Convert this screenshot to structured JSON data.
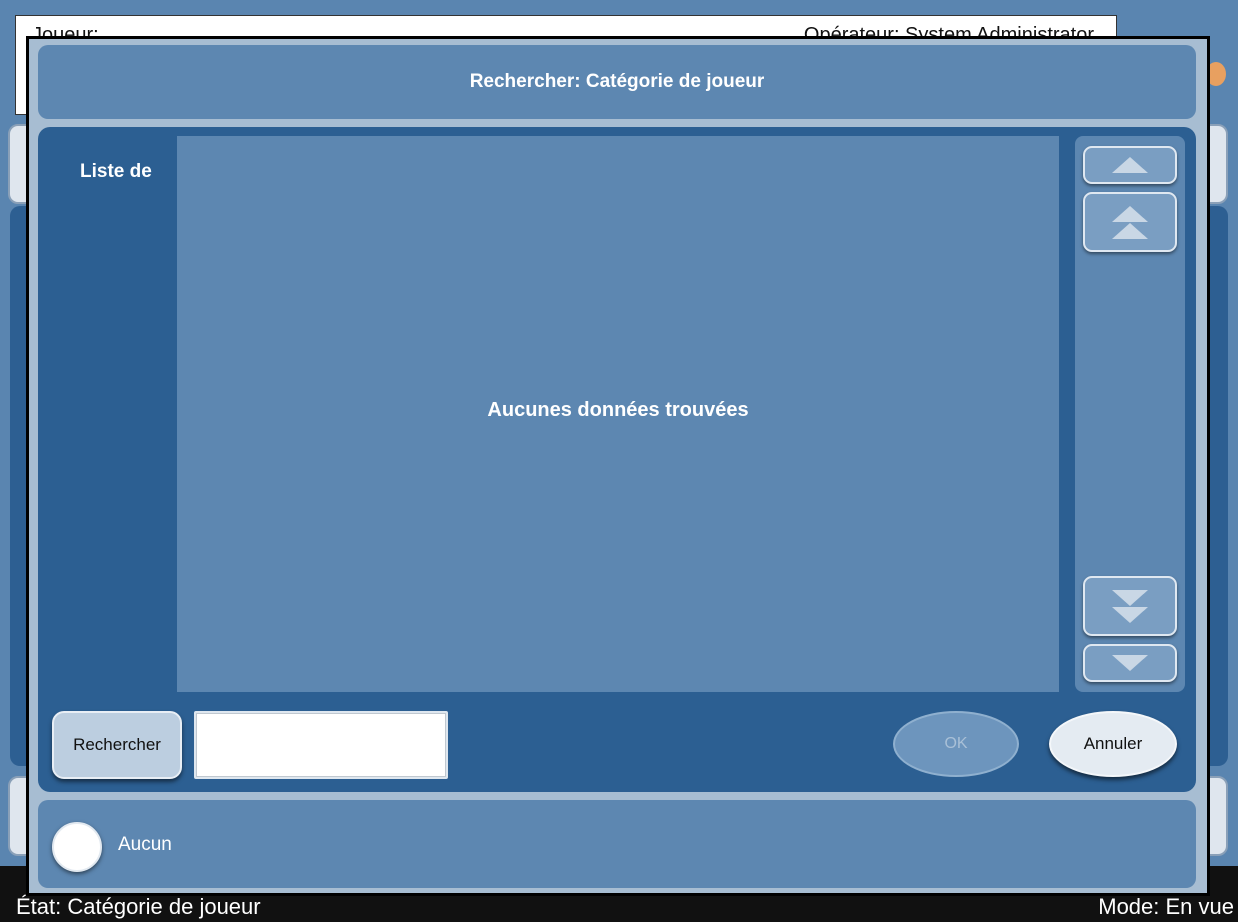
{
  "background": {
    "topbar_left_label": "Joueur:",
    "topbar_right_label": "Opérateur: System Administrator",
    "status_left": "État: Catégorie de joueur",
    "status_right": "Mode: En vue"
  },
  "dialog": {
    "title": "Rechercher: Catégorie de joueur",
    "list_label": "Liste de",
    "empty_message": "Aucunes données trouvées",
    "search_button_label": "Rechercher",
    "search_input_value": "",
    "ok_button_label": "OK",
    "cancel_button_label": "Annuler",
    "option_label": "Aucun",
    "scroll_icons": [
      "scroll-up-icon",
      "page-up-icon",
      "page-down-icon",
      "scroll-down-icon"
    ]
  },
  "colors": {
    "panel_dark": "#2c5f92",
    "panel_medium": "#5d87b1",
    "dialog_frame": "#a7bdd2",
    "button_light": "#bccee0"
  }
}
